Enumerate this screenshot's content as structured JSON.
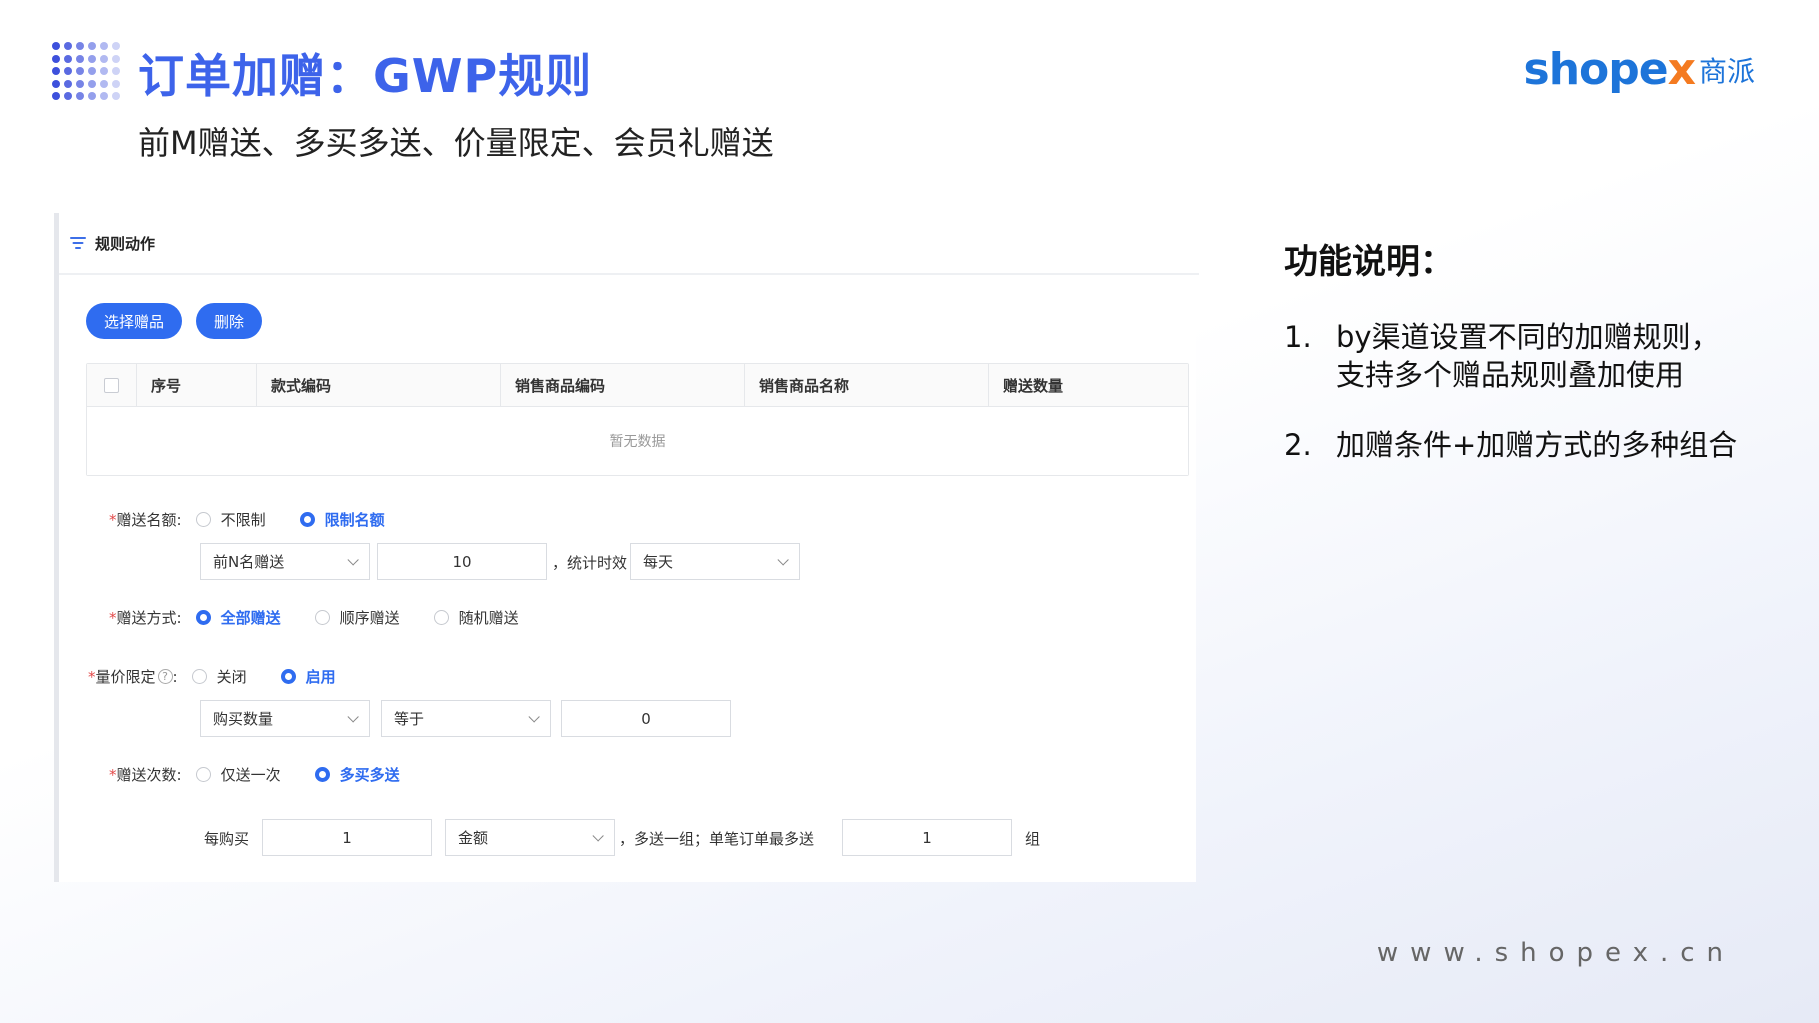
{
  "header": {
    "title": "订单加赠：GWP规则",
    "subtitle": "前M赠送、多买多送、价量限定、会员礼赠送"
  },
  "logo": {
    "word_pre": "shope",
    "word_x": "x",
    "cn": "商派"
  },
  "panel": {
    "section_title": "规则动作",
    "buttons": {
      "select_gift": "选择赠品",
      "delete": "删除"
    },
    "table": {
      "columns": [
        "序号",
        "款式编码",
        "销售商品编码",
        "销售商品名称",
        "赠送数量"
      ],
      "empty_text": "暂无数据"
    },
    "quota": {
      "label": "赠送名额:",
      "options": [
        "不限制",
        "限制名额"
      ],
      "selected": "限制名额",
      "mode_select": "前N名赠送",
      "count_value": "10",
      "period_label": "，统计时效",
      "period_select": "每天"
    },
    "gift_method": {
      "label": "赠送方式:",
      "options": [
        "全部赠送",
        "顺序赠送",
        "随机赠送"
      ],
      "selected": "全部赠送"
    },
    "qty_price": {
      "label": "量价限定",
      "colon": ":",
      "help": "?",
      "options": [
        "关闭",
        "启用"
      ],
      "selected": "启用",
      "field_select": "购买数量",
      "operator_select": "等于",
      "value": "0"
    },
    "gift_times": {
      "label": "赠送次数:",
      "options": [
        "仅送一次",
        "多买多送"
      ],
      "selected": "多买多送",
      "per_buy_label": "每购买",
      "per_buy_value": "1",
      "unit_select": "金额",
      "mid_text": "，多送一组；单笔订单最多送",
      "max_value": "1",
      "suffix": "组"
    }
  },
  "description": {
    "title": "功能说明：",
    "items": [
      {
        "num": "1.",
        "line1": "by渠道设置不同的加赠规则，",
        "line2": "支持多个赠品规则叠加使用"
      },
      {
        "num": "2.",
        "line1": "加赠条件+加赠方式的多种组合",
        "line2": ""
      }
    ]
  },
  "footer": {
    "url": "www.shopex.cn"
  },
  "colors": {
    "accent": "#2f6cf0",
    "title_blue": "#3d63ea",
    "logo_orange": "#f47a20",
    "required": "#e34b4b"
  }
}
